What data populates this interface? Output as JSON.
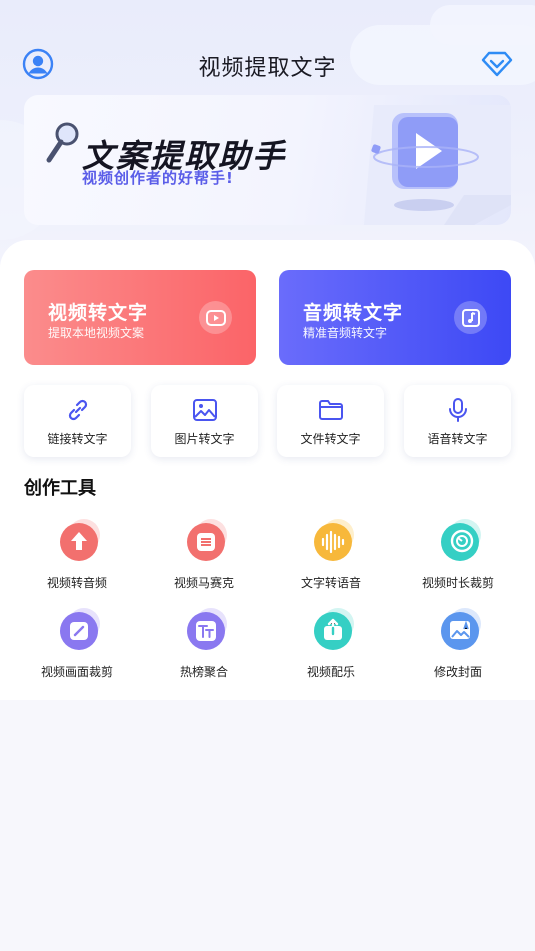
{
  "header": {
    "title": "视频提取文字",
    "avatar_icon": "user-avatar-icon",
    "vip_icon": "diamond-icon"
  },
  "banner": {
    "title": "文案提取助手",
    "subtitle": "视频创作者的好帮手!"
  },
  "primary_actions": [
    {
      "title": "视频转文字",
      "subtitle": "提取本地视频文案",
      "icon": "play-icon",
      "color": "#fb6f73"
    },
    {
      "title": "音频转文字",
      "subtitle": "精准音频转文字",
      "icon": "music-note-icon",
      "color": "#4a52f7"
    }
  ],
  "secondary_actions": [
    {
      "label": "链接转文字",
      "icon": "link-icon"
    },
    {
      "label": "图片转文字",
      "icon": "image-icon"
    },
    {
      "label": "文件转文字",
      "icon": "folder-icon"
    },
    {
      "label": "语音转文字",
      "icon": "microphone-icon"
    }
  ],
  "tools_section": {
    "title": "创作工具",
    "items": [
      {
        "label": "视频转音频",
        "icon": "upload-arrow-icon",
        "color": "#f2706e"
      },
      {
        "label": "视频马赛克",
        "icon": "mosaic-icon",
        "color": "#f2706e"
      },
      {
        "label": "文字转语音",
        "icon": "soundwave-icon",
        "color": "#f7b83b"
      },
      {
        "label": "视频时长裁剪",
        "icon": "timer-icon",
        "color": "#35cfc4"
      },
      {
        "label": "视频画面裁剪",
        "icon": "crop-icon",
        "color": "#8a78f0"
      },
      {
        "label": "热榜聚合",
        "icon": "text-format-icon",
        "color": "#8a78f0"
      },
      {
        "label": "视频配乐",
        "icon": "share-upload-icon",
        "color": "#35cfc4"
      },
      {
        "label": "修改封面",
        "icon": "cover-image-icon",
        "color": "#5b96ee"
      }
    ]
  }
}
